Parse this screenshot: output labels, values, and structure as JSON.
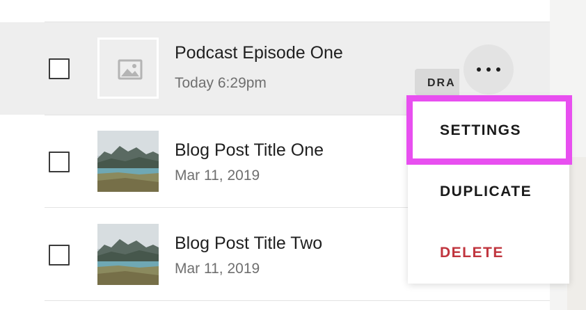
{
  "posts": [
    {
      "title": "Podcast Episode One",
      "date": "Today 6:29pm",
      "thumbnail": "image-placeholder-icon",
      "status": "DRA",
      "selected": false
    },
    {
      "title": "Blog Post Title One",
      "date": "Mar 11, 2019",
      "thumbnail": "landscape-thumbnail",
      "selected": false
    },
    {
      "title": "Blog Post Title Two",
      "date": "Mar 11, 2019",
      "thumbnail": "landscape-thumbnail",
      "selected": false
    }
  ],
  "more_button": {
    "icon": "more-horizontal-icon"
  },
  "context_menu": {
    "items": [
      {
        "label": "SETTINGS"
      },
      {
        "label": "DUPLICATE"
      },
      {
        "label": "DELETE"
      }
    ]
  },
  "colors": {
    "highlight": "#e84ff0",
    "danger": "#c0353e",
    "selected_row": "#eeeeee",
    "badge": "#d9d9d9"
  }
}
